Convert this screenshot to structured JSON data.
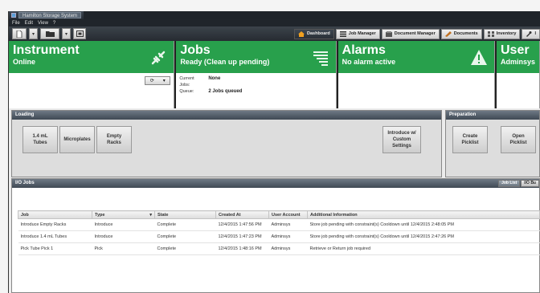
{
  "window": {
    "title": "Hamilton Storage System"
  },
  "menu": [
    "File",
    "Edit",
    "View",
    "?"
  ],
  "nav_tabs": [
    {
      "label": "Dashboard",
      "icon": "home-icon"
    },
    {
      "label": "Job Manager",
      "icon": "list-icon"
    },
    {
      "label": "Document Manager",
      "icon": "document-manager-icon"
    },
    {
      "label": "Documents",
      "icon": "documents-icon"
    },
    {
      "label": "Inventory",
      "icon": "inventory-icon"
    },
    {
      "label": "I",
      "icon": "wrench-icon"
    }
  ],
  "status": {
    "instrument": {
      "title": "Instrument",
      "sub": "Online"
    },
    "jobs": {
      "title": "Jobs",
      "sub": "Ready (Clean up pending)",
      "current_label": "Current Jobs:",
      "current_value": "None",
      "queue_label": "Queue:",
      "queue_value": "2 Jobs queued"
    },
    "alarms": {
      "title": "Alarms",
      "sub": "No alarm active"
    },
    "user": {
      "title": "User",
      "sub": "Adminsys"
    }
  },
  "loading": {
    "title": "Loading",
    "buttons": [
      "1.4 mL\nTubes",
      "Microplates",
      "Empty\nRacks",
      "Introduce w/\nCustom\nSettings"
    ]
  },
  "preparation": {
    "title": "Preparation",
    "buttons": [
      "Create\nPicklist",
      "Open\nPicklist"
    ]
  },
  "io": {
    "title": "I/O Jobs",
    "view_buttons": [
      "Job List",
      "I/O Bu"
    ],
    "columns": [
      "Job",
      "Type",
      "State",
      "Created At",
      "User Account",
      "Additional Information"
    ],
    "rows": [
      [
        "Introduce Empty Racks",
        "Introduce",
        "Complete",
        "12/4/2015 1:47:56 PM",
        "Adminsys",
        "Store job pending with constraint(s) Cooldown until 12/4/2015 2:48:05 PM"
      ],
      [
        "Introduce 1.4 mL Tubes",
        "Introduce",
        "Complete",
        "12/4/2015 1:47:23 PM",
        "Adminsys",
        "Store job pending with constraint(s) Cooldown until 12/4/2015 2:47:26 PM"
      ],
      [
        "Pick Tube Pick 1",
        "Pick",
        "Complete",
        "12/4/2015 1:48:16 PM",
        "Adminsys",
        "Retrieve or Return job required"
      ]
    ]
  }
}
